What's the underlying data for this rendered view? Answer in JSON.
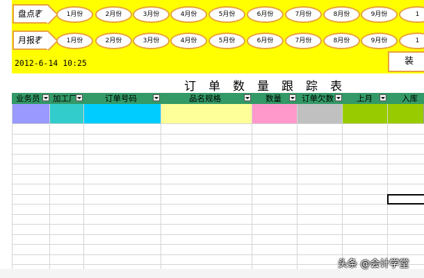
{
  "inventory": {
    "label": "盘点表",
    "months": [
      "1月份",
      "2月份",
      "3月份",
      "4月份",
      "5月份",
      "6月份",
      "7月份",
      "8月份",
      "9月份",
      "1"
    ]
  },
  "monthly": {
    "label": "月报表",
    "months": [
      "1月份",
      "2月份",
      "3月份",
      "4月份",
      "5月份",
      "6月份",
      "7月份",
      "8月份",
      "9月份",
      "1"
    ]
  },
  "datetime": "2012-6-14 10:25",
  "load_button": "装",
  "title": "订单数量跟踪表",
  "columns": [
    {
      "label": "业务员",
      "color": "#9999ff"
    },
    {
      "label": "加工厂",
      "color": "#33cccc"
    },
    {
      "label": "订单号码",
      "color": "#00ccff"
    },
    {
      "label": "品名规格",
      "color": "#ffff99"
    },
    {
      "label": "数量",
      "color": "#ff99cc"
    },
    {
      "label": "订单欠数",
      "color": "#c0c0c0"
    },
    {
      "label": "上月",
      "color": "#99cc00"
    },
    {
      "label": "入库",
      "color": "#99cc00"
    }
  ],
  "watermark": "头条 @会计学堂",
  "colors": {
    "panel": "#ffff00",
    "header": "#339966",
    "border": "#e7a03c"
  }
}
